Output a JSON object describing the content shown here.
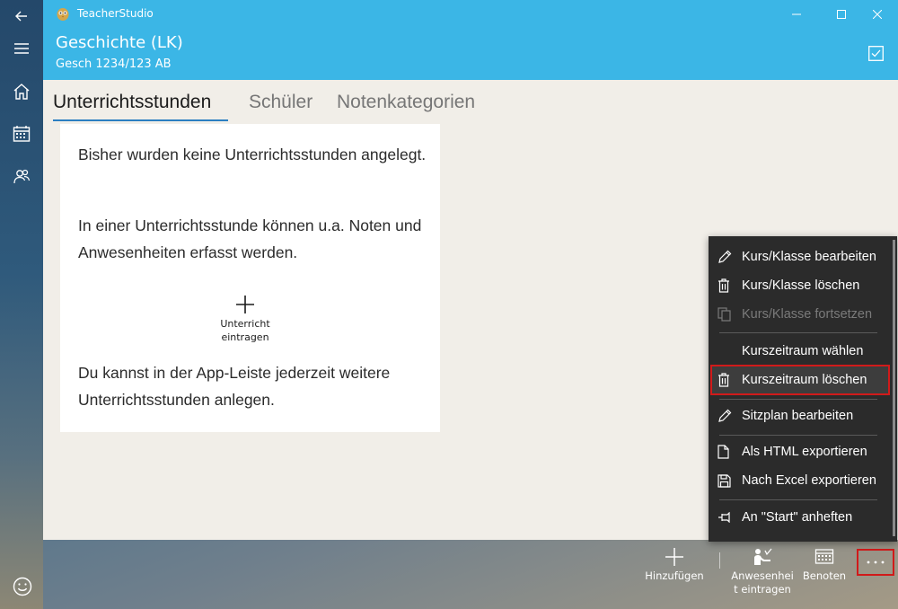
{
  "app": {
    "title": "TeacherStudio"
  },
  "header": {
    "course_title": "Geschichte (LK)",
    "course_code": "Gesch 1234/123 AB"
  },
  "tabs": [
    {
      "label": "Unterrichtsstunden",
      "active": true
    },
    {
      "label": "Schüler",
      "active": false
    },
    {
      "label": "Notenkategorien",
      "active": false
    }
  ],
  "empty_state": {
    "paragraph1": "Bisher wurden keine Unterrichtsstunden angelegt.",
    "paragraph2": "In einer Unterrichtsstunde können u.a. Noten und Anwesenheiten erfasst werden.",
    "add_label_line1": "Unterricht",
    "add_label_line2": "eintragen",
    "paragraph3": "Du kannst in der App-Leiste jederzeit weitere Unterrichtsstunden anlegen."
  },
  "menu": {
    "items": [
      {
        "label": "Kurs/Klasse bearbeiten",
        "icon": "pencil-icon",
        "enabled": true
      },
      {
        "label": "Kurs/Klasse löschen",
        "icon": "trash-icon",
        "enabled": true
      },
      {
        "label": "Kurs/Klasse fortsetzen",
        "icon": "copy-icon",
        "enabled": false
      },
      {
        "label": "Kurszeitraum wählen",
        "icon": "",
        "enabled": true
      },
      {
        "label": "Kurszeitraum löschen",
        "icon": "trash-icon",
        "enabled": true,
        "highlighted": true
      },
      {
        "label": "Sitzplan bearbeiten",
        "icon": "pencil-icon",
        "enabled": true
      },
      {
        "label": "Als HTML exportieren",
        "icon": "document-icon",
        "enabled": true
      },
      {
        "label": "Nach Excel exportieren",
        "icon": "save-icon",
        "enabled": true
      },
      {
        "label": "An \"Start\" anheften",
        "icon": "pin-icon",
        "enabled": true
      }
    ]
  },
  "commandbar": {
    "add_label": "Hinzufügen",
    "attendance_label_line1": "Anwesenhei",
    "attendance_label_line2": "t eintragen",
    "grade_label": "Benoten",
    "more_label": "···"
  },
  "colors": {
    "accent": "#3bb6e6",
    "highlight_border": "#d11a1a",
    "menu_bg": "#2b2b2b",
    "content_bg": "#f1eee8"
  }
}
